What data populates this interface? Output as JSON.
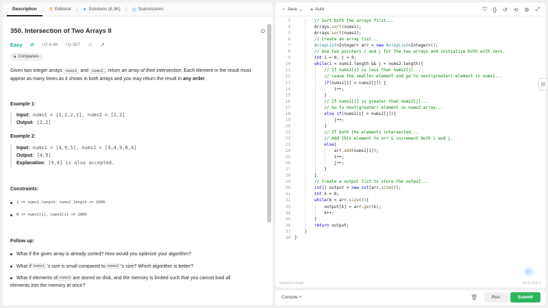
{
  "tabs": [
    {
      "label": "Description",
      "icon": ""
    },
    {
      "label": "Editorial",
      "icon": "flask-icon"
    },
    {
      "label": "Solutions (6.3K)",
      "icon": "lightbulb-icon"
    },
    {
      "label": "Submissions",
      "icon": "clock-icon"
    }
  ],
  "problem": {
    "title": "350. Intersection of Two Arrays II",
    "difficulty": "Easy",
    "likes": "6.9K",
    "dislikes": "907",
    "companies_label": "Companies",
    "desc_line1_a": "Given two integer arrays ",
    "desc_code1": "nums1",
    "desc_line1_b": " and ",
    "desc_code2": "nums2",
    "desc_line1_c": ", return ",
    "desc_line1_em": "an array of their intersection",
    "desc_line1_d": ". Each element in the result must",
    "desc_line2_a": "appear as many times as it shows in both arrays and you may return the result in ",
    "desc_line2_b": "any order",
    "desc_line2_c": "."
  },
  "examples": [
    {
      "heading": "Example 1:",
      "input_label": "Input:",
      "input": "nums1 = [1,2,2,1], nums2 = [2,2]",
      "output_label": "Output:",
      "output": "[2,2]"
    },
    {
      "heading": "Example 2:",
      "input_label": "Input:",
      "input": "nums1 = [4,9,5], nums2 = [9,4,9,8,4]",
      "output_label": "Output:",
      "output": "[4,9]",
      "expl_label": "Explanation:",
      "expl": "[9,4] is also accepted."
    }
  ],
  "constraints": {
    "heading": "Constraints:",
    "items": [
      "1 <= nums1.length, nums2.length <= 1000",
      "0 <= nums1[i], nums2[i] <= 1000"
    ]
  },
  "followup": {
    "heading": "Follow up:",
    "q1": "What if the given array is already sorted? How would you optimize your algorithm?",
    "q2_a": "What if ",
    "q2_c1": "nums1",
    "q2_b": "'s size is small compared to ",
    "q2_c2": "nums2",
    "q2_d": "'s size? Which algorithm is better?",
    "q3_a": "What if elements of ",
    "q3_c": "nums2",
    "q3_b": " are stored on disk, and the memory is limited such that you cannot load all",
    "q3_line2": "elements into the memory at once?"
  },
  "editor": {
    "language": "Java",
    "mode": "Auto",
    "saved_status": "Saved to local",
    "cursor": "Ln 1, Col 1"
  },
  "code_lines": [
    {
      "n": "3",
      "indent": 2,
      "parts": [
        [
          "cm",
          "// Sort both the arrays first..."
        ]
      ]
    },
    {
      "n": "4",
      "indent": 2,
      "parts": [
        [
          "",
          "Arrays."
        ],
        [
          "fn",
          "sort"
        ],
        [
          "",
          "(nums1);"
        ]
      ]
    },
    {
      "n": "5",
      "indent": 2,
      "parts": [
        [
          "",
          "Arrays."
        ],
        [
          "fn",
          "sort"
        ],
        [
          "",
          "(nums2);"
        ]
      ]
    },
    {
      "n": "6",
      "indent": 2,
      "parts": [
        [
          "cm",
          "// Create an array list..."
        ]
      ]
    },
    {
      "n": "7",
      "indent": 2,
      "parts": [
        [
          "ty",
          "ArrayList"
        ],
        [
          "",
          "<Integer> arr = "
        ],
        [
          "kw",
          "new "
        ],
        [
          "ty",
          "ArrayList"
        ],
        [
          "",
          "<Integer>();"
        ]
      ]
    },
    {
      "n": "8",
      "indent": 2,
      "parts": [
        [
          "cm",
          "// Use two pointers i and j for the two arrays and initialize both with zero."
        ]
      ]
    },
    {
      "n": "9",
      "indent": 2,
      "parts": [
        [
          "kw",
          "int "
        ],
        [
          "",
          "i = 0, j = 0;"
        ]
      ]
    },
    {
      "n": "10",
      "indent": 2,
      "parts": [
        [
          "kw",
          "while"
        ],
        [
          "",
          "(i < nums1.length && j < nums2.length){"
        ]
      ]
    },
    {
      "n": "11",
      "indent": 3,
      "parts": [
        [
          "cm",
          "// If nums1[i] is less than nums2[j]..."
        ]
      ]
    },
    {
      "n": "12",
      "indent": 3,
      "parts": [
        [
          "cm",
          "// Leave the smaller element and go to next(greater) element in nums1..."
        ]
      ]
    },
    {
      "n": "13",
      "indent": 3,
      "parts": [
        [
          "kw",
          "if"
        ],
        [
          "",
          "(nums1[i] < nums2[j]) {"
        ]
      ]
    },
    {
      "n": "14",
      "indent": 4,
      "parts": [
        [
          "",
          "i++;"
        ]
      ]
    },
    {
      "n": "15",
      "indent": 3,
      "parts": [
        [
          "",
          "}"
        ]
      ]
    },
    {
      "n": "16",
      "indent": 3,
      "parts": [
        [
          "cm",
          "// If nums1[i] is greater than nums2[j]..."
        ]
      ]
    },
    {
      "n": "17",
      "indent": 3,
      "parts": [
        [
          "cm",
          "// Go to next(greater) element in nums2 array..."
        ]
      ]
    },
    {
      "n": "18",
      "indent": 3,
      "parts": [
        [
          "kw",
          "else if"
        ],
        [
          "",
          "(nums1[i] > nums2[j]){"
        ]
      ]
    },
    {
      "n": "19",
      "indent": 4,
      "parts": [
        [
          "",
          "j++;"
        ]
      ]
    },
    {
      "n": "20",
      "indent": 3,
      "parts": [
        [
          "",
          "}"
        ]
      ]
    },
    {
      "n": "21",
      "indent": 3,
      "parts": [
        [
          "cm",
          "// If both the elements intersected..."
        ]
      ]
    },
    {
      "n": "22",
      "indent": 3,
      "parts": [
        [
          "cm",
          "// Add this element to arr & increment both i and j."
        ]
      ]
    },
    {
      "n": "23",
      "indent": 3,
      "parts": [
        [
          "kw",
          "else"
        ],
        [
          "",
          "{"
        ]
      ]
    },
    {
      "n": "24",
      "indent": 4,
      "parts": [
        [
          "",
          "arr."
        ],
        [
          "fn",
          "add"
        ],
        [
          "",
          "(nums1[i]);"
        ]
      ]
    },
    {
      "n": "25",
      "indent": 4,
      "parts": [
        [
          "",
          "i++;"
        ]
      ]
    },
    {
      "n": "26",
      "indent": 4,
      "parts": [
        [
          "",
          "j++;"
        ]
      ]
    },
    {
      "n": "27",
      "indent": 3,
      "parts": [
        [
          "",
          "}"
        ]
      ]
    },
    {
      "n": "28",
      "indent": 2,
      "parts": [
        [
          "",
          "}"
        ]
      ]
    },
    {
      "n": "29",
      "indent": 2,
      "parts": [
        [
          "cm",
          "// Create a output list to store the output..."
        ]
      ]
    },
    {
      "n": "30",
      "indent": 2,
      "parts": [
        [
          "kw",
          "int"
        ],
        [
          "",
          "[] output = "
        ],
        [
          "kw",
          "new int"
        ],
        [
          "",
          "[arr."
        ],
        [
          "fn",
          "size"
        ],
        [
          "",
          "()];"
        ]
      ]
    },
    {
      "n": "31",
      "indent": 2,
      "parts": [
        [
          "kw",
          "int "
        ],
        [
          "",
          "k = 0;"
        ]
      ]
    },
    {
      "n": "32",
      "indent": 2,
      "parts": [
        [
          "kw",
          "while"
        ],
        [
          "",
          "(k < arr."
        ],
        [
          "fn",
          "size"
        ],
        [
          "",
          "()){"
        ]
      ]
    },
    {
      "n": "33",
      "indent": 3,
      "parts": [
        [
          "",
          "output[k] = arr."
        ],
        [
          "fn",
          "get"
        ],
        [
          "",
          "(k);"
        ]
      ]
    },
    {
      "n": "34",
      "indent": 3,
      "parts": [
        [
          "",
          "k++;"
        ]
      ]
    },
    {
      "n": "35",
      "indent": 2,
      "parts": [
        [
          "",
          "}"
        ]
      ]
    },
    {
      "n": "36",
      "indent": 2,
      "parts": [
        [
          "kw",
          "return "
        ],
        [
          "",
          "output;"
        ]
      ]
    },
    {
      "n": "37",
      "indent": 1,
      "parts": [
        [
          "",
          "}"
        ]
      ]
    },
    {
      "n": "38",
      "indent": 0,
      "parts": [
        [
          "",
          "}"
        ]
      ]
    }
  ],
  "bottom": {
    "console_label": "Console",
    "run_label": "Run",
    "submit_label": "Submit"
  }
}
